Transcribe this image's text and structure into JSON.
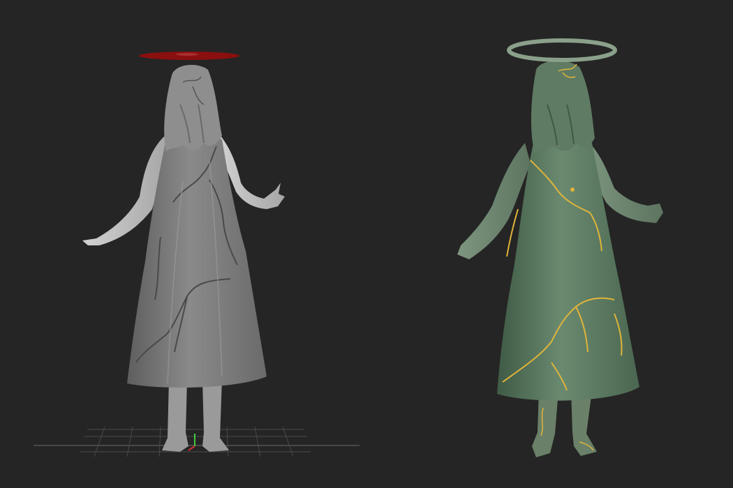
{
  "canvas": {
    "background": "#252525"
  },
  "panels": [
    {
      "name": "sculpt-view",
      "style": "untextured-clay",
      "cloth_color": "#7a7a7a",
      "skin_color": "#bdbdbd",
      "halo_color": "#8a0f0f",
      "shows_floor_grid": true,
      "shows_gizmo": true
    },
    {
      "name": "textured-render",
      "style": "painted-patina",
      "cloth_color": "#55705a",
      "skin_color": "#6f8771",
      "halo_color": "#8aa08a",
      "crack_color": "#e0b43a",
      "shows_floor_grid": false,
      "shows_gizmo": false
    }
  ]
}
